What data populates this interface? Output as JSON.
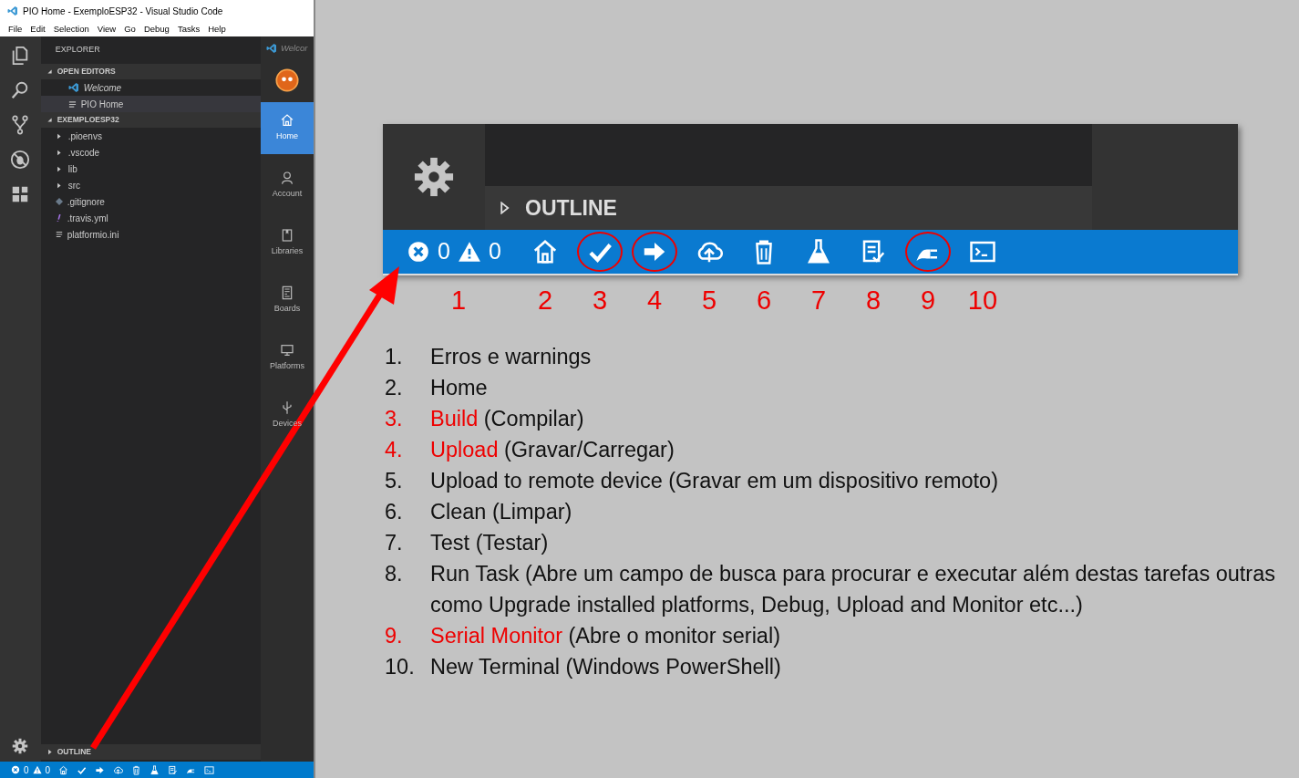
{
  "window": {
    "title": "PIO Home - ExemploESP32 - Visual Studio Code",
    "menu": [
      "File",
      "Edit",
      "Selection",
      "View",
      "Go",
      "Debug",
      "Tasks",
      "Help"
    ]
  },
  "explorer": {
    "title": "EXPLORER",
    "open_editors": {
      "label": "OPEN EDITORS",
      "expanded": true,
      "items": [
        {
          "label": "Welcome",
          "kind": "preview",
          "selected": false
        },
        {
          "label": "PIO Home",
          "kind": "file",
          "selected": true
        }
      ]
    },
    "project": {
      "label": "EXEMPLOESP32",
      "expanded": true,
      "items": [
        {
          "label": ".pioenvs",
          "kind": "folder"
        },
        {
          "label": ".vscode",
          "kind": "folder"
        },
        {
          "label": "lib",
          "kind": "folder"
        },
        {
          "label": "src",
          "kind": "folder"
        },
        {
          "label": ".gitignore",
          "kind": "git"
        },
        {
          "label": ".travis.yml",
          "kind": "yaml"
        },
        {
          "label": "platformio.ini",
          "kind": "file"
        }
      ]
    },
    "outline": {
      "label": "OUTLINE",
      "expanded": false
    }
  },
  "pio_panel": {
    "tab": "Welcor",
    "nav": [
      {
        "label": "Home",
        "kind": "home",
        "selected": true
      },
      {
        "label": "Account",
        "kind": "account",
        "selected": false
      },
      {
        "label": "Libraries",
        "kind": "libraries",
        "selected": false
      },
      {
        "label": "Boards",
        "kind": "boards",
        "selected": false
      },
      {
        "label": "Platforms",
        "kind": "platforms",
        "selected": false
      },
      {
        "label": "Devices",
        "kind": "devices",
        "selected": false
      }
    ]
  },
  "status_bar": {
    "errors": "0",
    "warnings": "0",
    "buttons": [
      {
        "kind": "home"
      },
      {
        "kind": "build"
      },
      {
        "kind": "upload"
      },
      {
        "kind": "remote"
      },
      {
        "kind": "clean"
      },
      {
        "kind": "test"
      },
      {
        "kind": "task"
      },
      {
        "kind": "serial"
      },
      {
        "kind": "terminal"
      }
    ]
  },
  "zoomed_status_bar": {
    "outline": "OUTLINE",
    "errors": "0",
    "warnings": "0",
    "number": "1",
    "buttons": [
      {
        "kind": "home",
        "number": "2",
        "circled": false
      },
      {
        "kind": "build",
        "number": "3",
        "circled": true
      },
      {
        "kind": "upload",
        "number": "4",
        "circled": true
      },
      {
        "kind": "remote",
        "number": "5",
        "circled": false
      },
      {
        "kind": "clean",
        "number": "6",
        "circled": false
      },
      {
        "kind": "test",
        "number": "7",
        "circled": false
      },
      {
        "kind": "task",
        "number": "8",
        "circled": false
      },
      {
        "kind": "serial",
        "number": "9",
        "circled": true
      },
      {
        "kind": "terminal",
        "number": "10",
        "circled": false
      }
    ]
  },
  "legend": [
    {
      "number": "1.",
      "label": "Erros e warnings",
      "highlighted": false
    },
    {
      "number": "2.",
      "label": "Home",
      "highlighted": false
    },
    {
      "number": "3.",
      "label": "Build",
      "note": "(Compilar)",
      "highlighted": true
    },
    {
      "number": "4.",
      "label": "Upload",
      "note": "(Gravar/Carregar)",
      "highlighted": true
    },
    {
      "number": "5.",
      "label": "Upload to remote device (Gravar em um dispositivo remoto)",
      "highlighted": false
    },
    {
      "number": "6.",
      "label": "Clean (Limpar)",
      "highlighted": false
    },
    {
      "number": "7.",
      "label": "Test (Testar)",
      "highlighted": false
    },
    {
      "number": "8.",
      "label": "Run Task (Abre um campo de busca para procurar e executar além destas tarefas outras como Upgrade installed platforms, Debug, Upload and Monitor etc...)",
      "highlighted": false
    },
    {
      "number": "9.",
      "label": "Serial Monitor",
      "note": "(Abre o monitor serial)",
      "highlighted": true
    },
    {
      "number": "10.",
      "label": "New Terminal (Windows PowerShell)",
      "highlighted": false
    }
  ]
}
